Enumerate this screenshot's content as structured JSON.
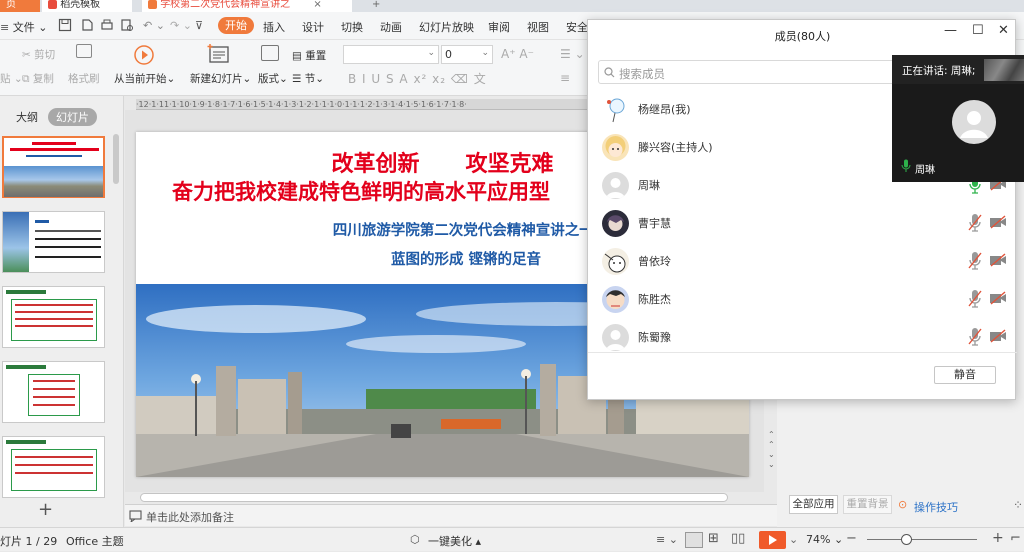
{
  "tabs": {
    "t1": "页",
    "t2": "稻壳模板",
    "t3": "学校第二次党代会精神宣讲之"
  },
  "menu": {
    "file": "文件",
    "start": "开始",
    "insert": "插入",
    "design": "设计",
    "transition": "切换",
    "animation": "动画",
    "slideshow": "幻灯片放映",
    "review": "审阅",
    "view": "视图",
    "security": "安全"
  },
  "toolbar": {
    "cut": "剪切",
    "format_painter": "格式刷",
    "paste": "贴",
    "copy": "复制",
    "from_current": "从当前开始",
    "new_slide": "新建幻灯片",
    "layout": "版式",
    "section": "节",
    "reset": "重置",
    "font_size": "0",
    "font_letters": "B  I  U  S  A  x²  x₂  ⌫  文"
  },
  "sidebar": {
    "tab_outline": "大纲",
    "tab_slides": "幻灯片",
    "add": "+"
  },
  "ruler": "·12·1·11·1·10·1·9·1·8·1·7·1·6·1·5·1·4·1·3·1·2·1·1·1·0·1·1·1·2·1·3·1·4·1·5·1·6·1·7·1·8·",
  "slide": {
    "title1": "改革创新      攻坚克难",
    "title2": "奋力把我校建成特色鲜明的高水平应用型",
    "subtitle1": "四川旅游学院第二次党代会精神宣讲之一i",
    "subtitle2": "蓝图的形成  铿锵的足音"
  },
  "notes": {
    "placeholder": "单击此处添加备注"
  },
  "right_panel": {
    "apply_all": "全部应用",
    "reset_bg": "重置背景",
    "tips": "操作技巧"
  },
  "status": {
    "slide_count": "灯片 1 / 29",
    "theme": "Office 主题",
    "beautify": "一键美化",
    "zoom": "74%"
  },
  "members": {
    "title": "成员(80人)",
    "search_placeholder": "搜索成员",
    "mute_all": "静音",
    "list": [
      {
        "name": "杨继昂(我)"
      },
      {
        "name": "滕兴容(主持人)"
      },
      {
        "name": "周琳"
      },
      {
        "name": "曹宇慧"
      },
      {
        "name": "曾依玲"
      },
      {
        "name": "陈胜杰"
      },
      {
        "name": "陈蜀豫"
      }
    ]
  },
  "speaker": {
    "speaking_label": "正在讲话: 周琳;",
    "name": "周琳"
  },
  "colors": {
    "accent_orange": "#f07a3c",
    "slide_title_red": "#e3001b",
    "slide_subtitle_blue": "#1f5aa6",
    "mic_green": "#2db24b",
    "mute_red": "#e0533a"
  }
}
